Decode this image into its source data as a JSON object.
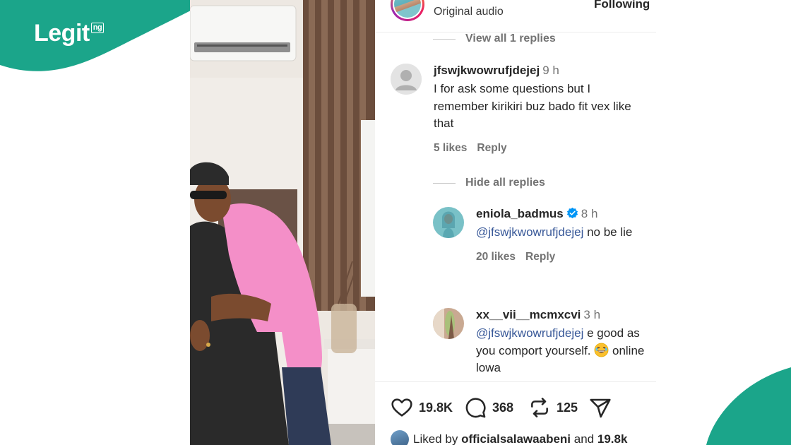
{
  "brand": {
    "name": "Legit",
    "suffix": "ng",
    "color": "#1ba58a"
  },
  "header": {
    "audio_label": "Original audio",
    "follow_label": "Following"
  },
  "thread": {
    "view_replies_label": "View all 1 replies",
    "hide_replies_label": "Hide all replies"
  },
  "comments": [
    {
      "username": "jfswjkwowrufjdejej",
      "time": "9 h",
      "text": "I for ask some questions but I remember kirikiri buz bado fit vex like that",
      "likes": "5 likes",
      "reply_label": "Reply"
    },
    {
      "username": "eniola_badmus",
      "verified": true,
      "time": "8 h",
      "mention": "@jfswjkwowrufjdejej",
      "text": "no be lie",
      "likes": "20 likes",
      "reply_label": "Reply"
    },
    {
      "username": "xx__vii__mcmxcvi",
      "time": "3 h",
      "mention": "@jfswjkwowrufjdejej",
      "text": "e good as you comport yourself.",
      "emoji": "laughing-face",
      "text_after": "online lowa"
    }
  ],
  "actions": {
    "likes_count": "19.8K",
    "comments_count": "368",
    "reposts_count": "125"
  },
  "liked_by": {
    "prefix": "Liked by",
    "user": "officialsalawaabeni",
    "connector": "and",
    "count": "19.8k"
  },
  "colors": {
    "accent_link": "#385898",
    "verified_blue": "#0095f6",
    "muted": "#737373"
  }
}
